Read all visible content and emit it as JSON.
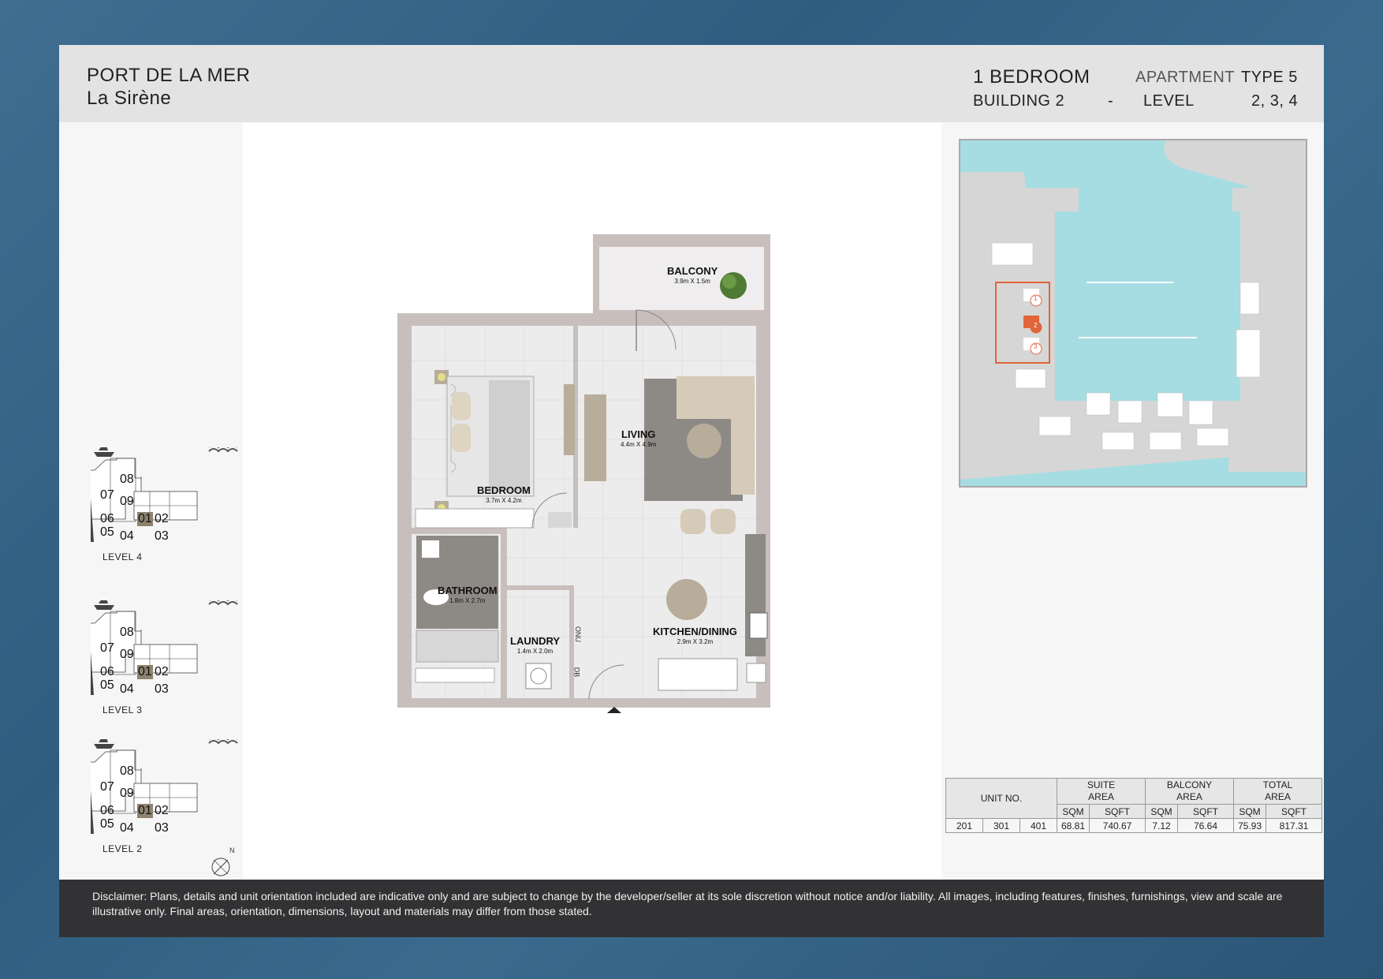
{
  "header": {
    "project": "PORT DE LA MER",
    "subproject": "La Sirène",
    "bedrooms": "1 BEDROOM",
    "building": "BUILDING 2",
    "dash": "-",
    "apartment_label": "APARTMENT",
    "type": "TYPE 5",
    "level_label": "LEVEL",
    "levels": "2, 3, 4"
  },
  "key_plans": [
    {
      "label": "LEVEL 4",
      "units": [
        "08",
        "07",
        "09",
        "06",
        "01",
        "02",
        "05",
        "04",
        "03"
      ],
      "highlight": "01"
    },
    {
      "label": "LEVEL 3",
      "units": [
        "08",
        "07",
        "09",
        "06",
        "01",
        "02",
        "05",
        "04",
        "03"
      ],
      "highlight": "01"
    },
    {
      "label": "LEVEL 2",
      "units": [
        "08",
        "07",
        "09",
        "06",
        "01",
        "02",
        "05",
        "04",
        "03"
      ],
      "highlight": "01"
    }
  ],
  "compass": {
    "north": "N"
  },
  "rooms": {
    "balcony": {
      "name": "BALCONY",
      "dim": "3.9m X 1.5m"
    },
    "living": {
      "name": "LIVING",
      "dim": "4.4m X 4.9m"
    },
    "bedroom": {
      "name": "BEDROOM",
      "dim": "3.7m X 4.2m"
    },
    "bathroom": {
      "name": "BATHROOM",
      "dim": "1.8m X 2.7m"
    },
    "laundry": {
      "name": "LAUNDRY",
      "dim": "1.4m X 2.0m"
    },
    "kitchen": {
      "name": "KITCHEN/DINING",
      "dim": "2.9m X 3.2m"
    },
    "onu": "ONU",
    "db": "DB"
  },
  "site_map": {
    "buildings": [
      "1",
      "2",
      "3"
    ],
    "highlight": "2",
    "highlight_color": "#e2643a",
    "water_color": "#a6dde2"
  },
  "area_table": {
    "unit_no_label": "UNIT NO.",
    "suite_label_1": "SUITE",
    "suite_label_2": "AREA",
    "balcony_label_1": "BALCONY",
    "balcony_label_2": "AREA",
    "total_label_1": "TOTAL",
    "total_label_2": "AREA",
    "sqm": "SQM",
    "sqft": "SQFT",
    "units": [
      "201",
      "301",
      "401"
    ],
    "suite_sqm": "68.81",
    "suite_sqft": "740.67",
    "balcony_sqm": "7.12",
    "balcony_sqft": "76.64",
    "total_sqm": "75.93",
    "total_sqft": "817.31"
  },
  "disclaimer": "Disclaimer: Plans, details and unit orientation included are indicative only and are subject to change by the developer/seller at its sole discretion without notice and/or liability. All images, including features, finishes, furnishings, view and scale are illustrative only. Final areas, orientation, dimensions, layout and materials may differ from those stated."
}
